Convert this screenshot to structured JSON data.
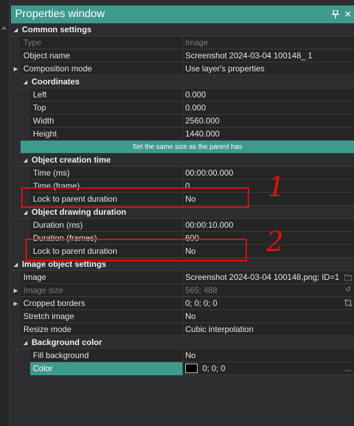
{
  "window": {
    "title": "Properties window",
    "pin_icon": "pin-icon",
    "close_icon": "close-icon"
  },
  "categories": {
    "common": "Common settings",
    "coordinates": "Coordinates",
    "creation_time": "Object creation time",
    "drawing_duration": "Object drawing duration",
    "image_settings": "Image object settings",
    "background_color": "Background color"
  },
  "rows": {
    "type": {
      "name": "Type",
      "value": "Image"
    },
    "object_name": {
      "name": "Object name",
      "value": "Screenshot 2024-03-04 100148_ 1"
    },
    "composition_mode": {
      "name": "Composition mode",
      "value": "Use layer's properties"
    },
    "left": {
      "name": "Left",
      "value": "0.000"
    },
    "top": {
      "name": "Top",
      "value": "0.000"
    },
    "width": {
      "name": "Width",
      "value": "2560.000"
    },
    "height": {
      "name": "Height",
      "value": "1440.000"
    },
    "set_same_size": {
      "label": "Set the same size as the parent has"
    },
    "time_ms": {
      "name": "Time (ms)",
      "value": "00:00:00.000"
    },
    "time_frame": {
      "name": "Time (frame)",
      "value": "0"
    },
    "lock_creation": {
      "name": "Lock to parent duration",
      "value": "No"
    },
    "duration_ms": {
      "name": "Duration (ms)",
      "value": "00:00:10.000"
    },
    "duration_frames": {
      "name": "Duration (frames)",
      "value": "600"
    },
    "lock_drawing": {
      "name": "Lock to parent duration",
      "value": "No"
    },
    "image": {
      "name": "Image",
      "value": "Screenshot 2024-03-04 100148.png; ID=1"
    },
    "image_size": {
      "name": "Image size",
      "value": "565; 488"
    },
    "cropped_borders": {
      "name": "Cropped borders",
      "value": "0; 0; 0; 0"
    },
    "stretch_image": {
      "name": "Stretch image",
      "value": "No"
    },
    "resize_mode": {
      "name": "Resize mode",
      "value": "Cubic interpolation"
    },
    "fill_background": {
      "name": "Fill background",
      "value": "No"
    },
    "color": {
      "name": "Color",
      "value": "0; 0; 0",
      "ellipsis": "...",
      "swatch_color": "#000000"
    }
  },
  "annotations": {
    "num1": "1",
    "num2": "2",
    "color": "#e01010"
  },
  "colors": {
    "accent": "#3f9a8e",
    "background": "#2d2d30",
    "row": "#252526"
  }
}
